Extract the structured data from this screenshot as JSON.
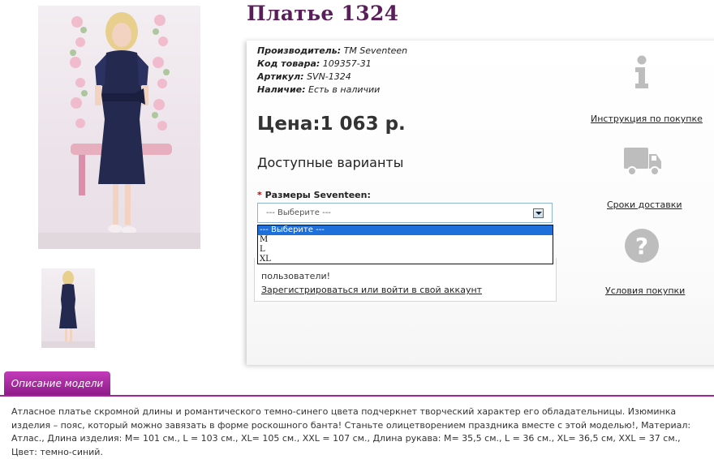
{
  "product": {
    "title": "Платье 1324",
    "manufacturer_label": "Производитель:",
    "manufacturer_value": "ТМ Seventeen",
    "code_label": "Код товара:",
    "code_value": "109357-31",
    "article_label": "Артикул:",
    "article_value": "SVN-1324",
    "availability_label": "Наличие:",
    "availability_value": "Есть в наличии",
    "price": "Цена:1 063 р."
  },
  "options": {
    "heading": "Доступные варианты",
    "size_label": "Размеры Seventeen:",
    "required_mark": "*",
    "select_value": "--- Выберите ---",
    "dropdown_options": [
      "--- Выберите ---",
      "M",
      "L",
      "XL"
    ]
  },
  "notice": {
    "text_line2": "пользователи!",
    "register_link": "Зарегистрироваться или войти в свой аккаунт"
  },
  "side_links": {
    "instruction": "Инструкция по покупке",
    "delivery": "Сроки доставки",
    "conditions": "Условия покупки"
  },
  "tabs": {
    "description_tab": "Описание модели"
  },
  "description": "Атласное платье скромной длины и романтического темно-синего цвета подчеркнет творческий характер его обладательницы. Изюминка изделия – пояс, который можно завязать в форме роскошного банта! Станьте олицетворением праздника вместе с этой моделью!, Материал: Атлас., Длина изделия: М= 101 см., L = 103 см., XL= 105 см., XXL = 107 см., Длина рукава: М= 35,5 см., L = 36 см., XL= 36,5 см, XXL = 37 см., Цвет: темно-синий."
}
